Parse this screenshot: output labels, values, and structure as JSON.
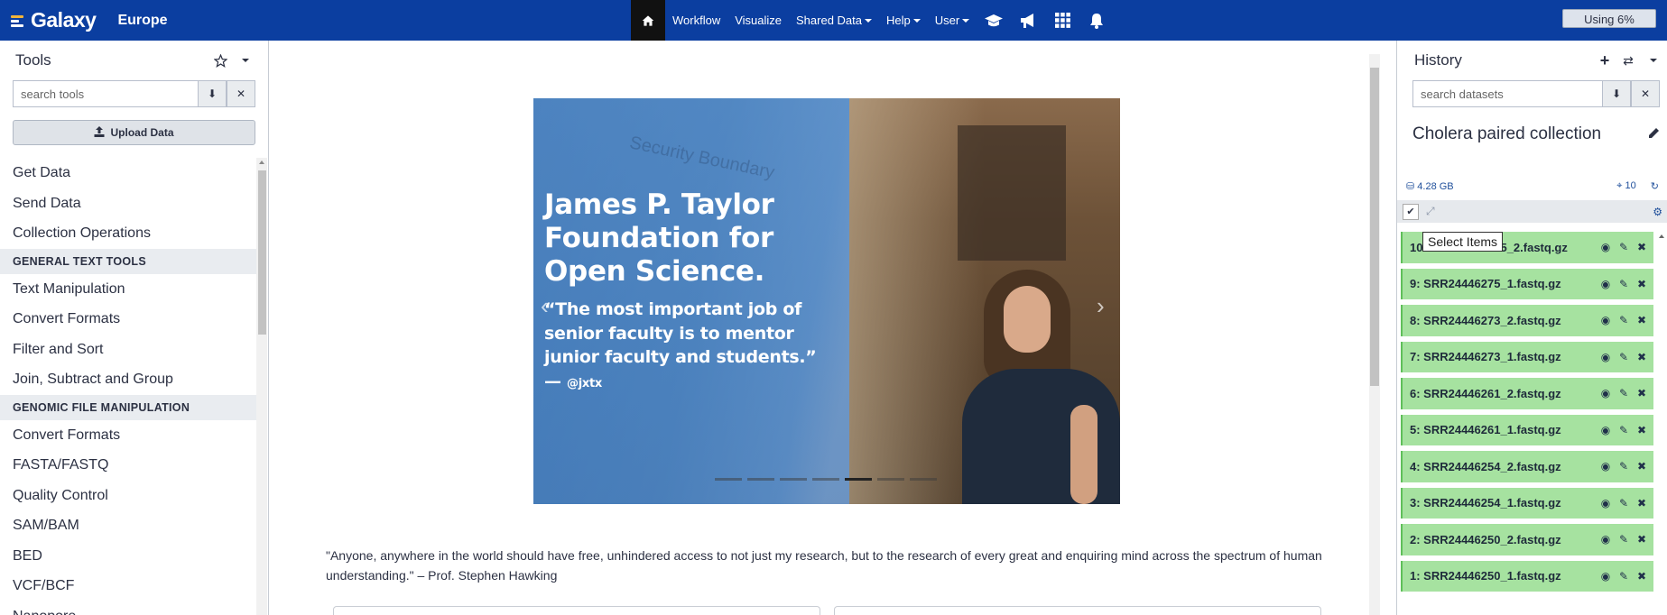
{
  "masthead": {
    "brand": "Galaxy",
    "subtitle": "Europe",
    "nav": [
      {
        "label": "Workflow",
        "dropdown": false
      },
      {
        "label": "Visualize",
        "dropdown": false
      },
      {
        "label": "Shared Data",
        "dropdown": true
      },
      {
        "label": "Help",
        "dropdown": true
      },
      {
        "label": "User",
        "dropdown": true
      }
    ],
    "icons": [
      "home-icon",
      "graduation-cap-icon",
      "megaphone-icon",
      "grid-icon",
      "bell-icon"
    ],
    "quota": "Using 6%",
    "colors": {
      "bar": "#0b3ea0",
      "home_active": "#111111"
    }
  },
  "tools": {
    "title": "Tools",
    "search_placeholder": "search tools",
    "upload_label": "Upload Data",
    "items": [
      {
        "type": "tool",
        "label": "Get Data"
      },
      {
        "type": "tool",
        "label": "Send Data"
      },
      {
        "type": "tool",
        "label": "Collection Operations"
      },
      {
        "type": "section",
        "label": "GENERAL TEXT TOOLS"
      },
      {
        "type": "tool",
        "label": "Text Manipulation"
      },
      {
        "type": "tool",
        "label": "Convert Formats"
      },
      {
        "type": "tool",
        "label": "Filter and Sort"
      },
      {
        "type": "tool",
        "label": "Join, Subtract and Group"
      },
      {
        "type": "section",
        "label": "GENOMIC FILE MANIPULATION"
      },
      {
        "type": "tool",
        "label": "Convert Formats"
      },
      {
        "type": "tool",
        "label": "FASTA/FASTQ"
      },
      {
        "type": "tool",
        "label": "Quality Control"
      },
      {
        "type": "tool",
        "label": "SAM/BAM"
      },
      {
        "type": "tool",
        "label": "BED"
      },
      {
        "type": "tool",
        "label": "VCF/BCF"
      },
      {
        "type": "tool",
        "label": "Nanopore"
      }
    ]
  },
  "center": {
    "carousel": {
      "watermark": "Security Boundary",
      "title": "James P. Taylor Foundation for Open Science.",
      "quote": "“The most important job of senior faculty is to mentor junior faculty and students.” —",
      "handle": "@jxtx",
      "indicator_count": 7,
      "active_index": 4
    },
    "quote_text": "\"Anyone, anywhere in the world should have free, unhindered access to not just my research, but to the research of every great and enquiring mind across the spectrum of human understanding.\" – Prof. Stephen Hawking"
  },
  "history": {
    "title": "History",
    "search_placeholder": "search datasets",
    "name": "Cholera paired collection",
    "size": "4.28 GB",
    "count": "10",
    "tooltip": "Select Items",
    "datasets": [
      {
        "label": "10: SRR24446275_2.fastq.gz"
      },
      {
        "label": "9: SRR24446275_1.fastq.gz"
      },
      {
        "label": "8: SRR24446273_2.fastq.gz"
      },
      {
        "label": "7: SRR24446273_1.fastq.gz"
      },
      {
        "label": "6: SRR24446261_2.fastq.gz"
      },
      {
        "label": "5: SRR24446261_1.fastq.gz"
      },
      {
        "label": "4: SRR24446254_2.fastq.gz"
      },
      {
        "label": "3: SRR24446254_1.fastq.gz"
      },
      {
        "label": "2: SRR24446250_2.fastq.gz"
      },
      {
        "label": "1: SRR24446250_1.fastq.gz"
      }
    ],
    "colors": {
      "ok_state": "#a6e2a0",
      "link": "#1f4f9b"
    }
  }
}
